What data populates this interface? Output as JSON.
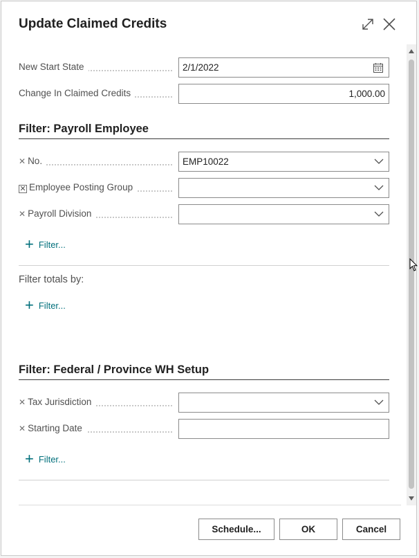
{
  "dialog": {
    "title": "Update Claimed Credits",
    "expand_icon": "expand-icon",
    "close_icon": "close-icon"
  },
  "fields": {
    "new_start_state": {
      "label": "New Start State",
      "value": "2/1/2022",
      "icon": "calendar-icon"
    },
    "change_in_claimed_credits": {
      "label": "Change In Claimed Credits",
      "value": "1,000.00"
    }
  },
  "payroll_employee_filter": {
    "title": "Filter: Payroll Employee",
    "rows": [
      {
        "label": "No.",
        "value": "EMP10022"
      },
      {
        "label": "Employee Posting Group",
        "value": ""
      },
      {
        "label": "Payroll Division",
        "value": ""
      }
    ],
    "add_filter": "Filter..."
  },
  "filter_totals": {
    "title": "Filter totals by:",
    "add_filter": "Filter..."
  },
  "wh_setup_filter": {
    "title": "Filter: Federal / Province WH Setup",
    "rows": [
      {
        "label": "Tax Jurisdiction",
        "value": ""
      },
      {
        "label": "Starting Date",
        "value": ""
      }
    ],
    "add_filter": "Filter..."
  },
  "buttons": {
    "schedule": "Schedule...",
    "ok": "OK",
    "cancel": "Cancel"
  },
  "colors": {
    "accent": "#006f7b",
    "border": "#8a8a8a"
  }
}
